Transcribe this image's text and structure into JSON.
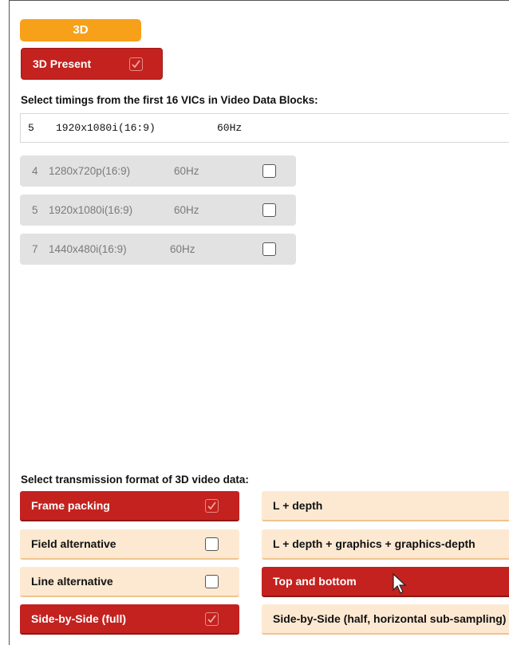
{
  "tab": {
    "label": "3D"
  },
  "present": {
    "label": "3D Present",
    "checked": true
  },
  "timings": {
    "heading": "Select timings from the first 16 VICs in Video Data Blocks:",
    "selected": {
      "vic": "5",
      "resolution": "1920x1080i(16:9)",
      "rate": "60Hz"
    },
    "items": [
      {
        "vic": "4",
        "resolution": "1280x720p(16:9)",
        "rate": "60Hz",
        "checked": false
      },
      {
        "vic": "5",
        "resolution": "1920x1080i(16:9)",
        "rate": "60Hz",
        "checked": false
      },
      {
        "vic": "7",
        "resolution": "1440x480i(16:9)",
        "rate": "60Hz",
        "checked": false
      }
    ]
  },
  "formats": {
    "heading": "Select transmission format of 3D video data:",
    "left": [
      {
        "label": "Frame packing",
        "checked": true
      },
      {
        "label": "Field alternative",
        "checked": false
      },
      {
        "label": "Line alternative",
        "checked": false
      },
      {
        "label": "Side-by-Side (full)",
        "checked": true
      }
    ],
    "right": [
      {
        "label": "L + depth",
        "active": false
      },
      {
        "label": "L + depth + graphics + graphics-depth",
        "active": false
      },
      {
        "label": "Top and bottom",
        "active": true
      },
      {
        "label": "Side-by-Side (half, horizontal sub-sampling)",
        "active": false
      }
    ]
  },
  "colors": {
    "accent": "#f7a11a",
    "active": "#c3221f",
    "inactive": "#fde9d2",
    "disabled": "#e2e2e2"
  }
}
